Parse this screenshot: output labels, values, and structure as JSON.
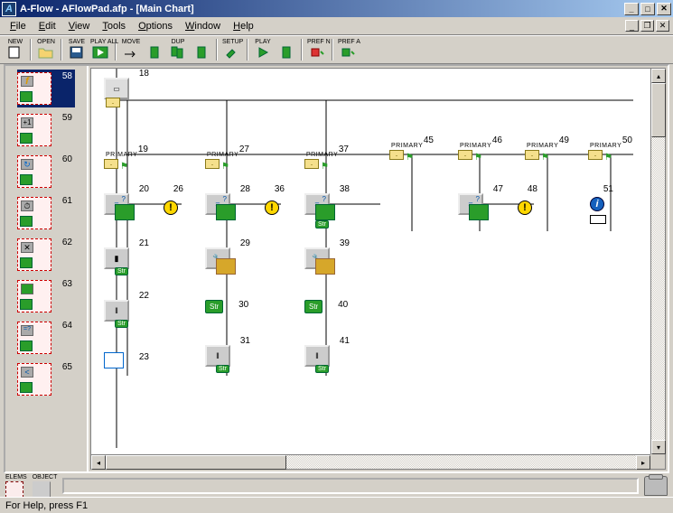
{
  "title": "A-Flow - AFlowPad.afp - [Main Chart]",
  "menus": [
    "File",
    "Edit",
    "View",
    "Tools",
    "Options",
    "Window",
    "Help"
  ],
  "toolbar": [
    {
      "label": "NEW",
      "icon": "doc"
    },
    {
      "sep": true
    },
    {
      "label": "OPEN",
      "icon": "folder"
    },
    {
      "sep": true
    },
    {
      "label": "SAVE",
      "icon": "disk"
    },
    {
      "label": "PLAY ALL",
      "icon": "play"
    },
    {
      "sep": true
    },
    {
      "label": "MOVE",
      "icon": "move"
    },
    {
      "label": "",
      "icon": "green1"
    },
    {
      "label": "DUP",
      "icon": "dup"
    },
    {
      "label": "",
      "icon": "green2"
    },
    {
      "sep": true
    },
    {
      "label": "SETUP",
      "icon": "wrench"
    },
    {
      "sep": true
    },
    {
      "label": "PLAY",
      "icon": "play2"
    },
    {
      "label": "",
      "icon": "green3"
    },
    {
      "sep": true
    },
    {
      "label": "PREF N",
      "icon": "pref-red"
    },
    {
      "sep": true
    },
    {
      "label": "PREF A",
      "icon": "pref-green"
    }
  ],
  "palette": [
    {
      "num": "58",
      "sel": true,
      "sym": "f"
    },
    {
      "num": "59",
      "sym": "+1"
    },
    {
      "num": "60",
      "sym": "↻"
    },
    {
      "num": "61",
      "sym": "⏱"
    },
    {
      "num": "62",
      "sym": "✕"
    },
    {
      "num": "63",
      "sym": "▦"
    },
    {
      "num": "64",
      "sym": "=?"
    },
    {
      "num": "65",
      "sym": "<"
    }
  ],
  "nodes": {
    "n18": "18",
    "n19": "19",
    "n20": "20",
    "n21": "21",
    "n22": "22",
    "n23": "23",
    "n26": "26",
    "n27": "27",
    "n28": "28",
    "n29": "29",
    "n30": "30",
    "n31": "31",
    "n36": "36",
    "n37": "37",
    "n38": "38",
    "n39": "39",
    "n40": "40",
    "n41": "41",
    "n45": "45",
    "n46": "46",
    "n47": "47",
    "n48": "48",
    "n49": "49",
    "n50": "50",
    "n51": "51",
    "primary": "PRIMARY",
    "str": "Str"
  },
  "bottom": {
    "elems": "ELEMS",
    "object": "OBJECT"
  },
  "status": "For Help, press F1"
}
